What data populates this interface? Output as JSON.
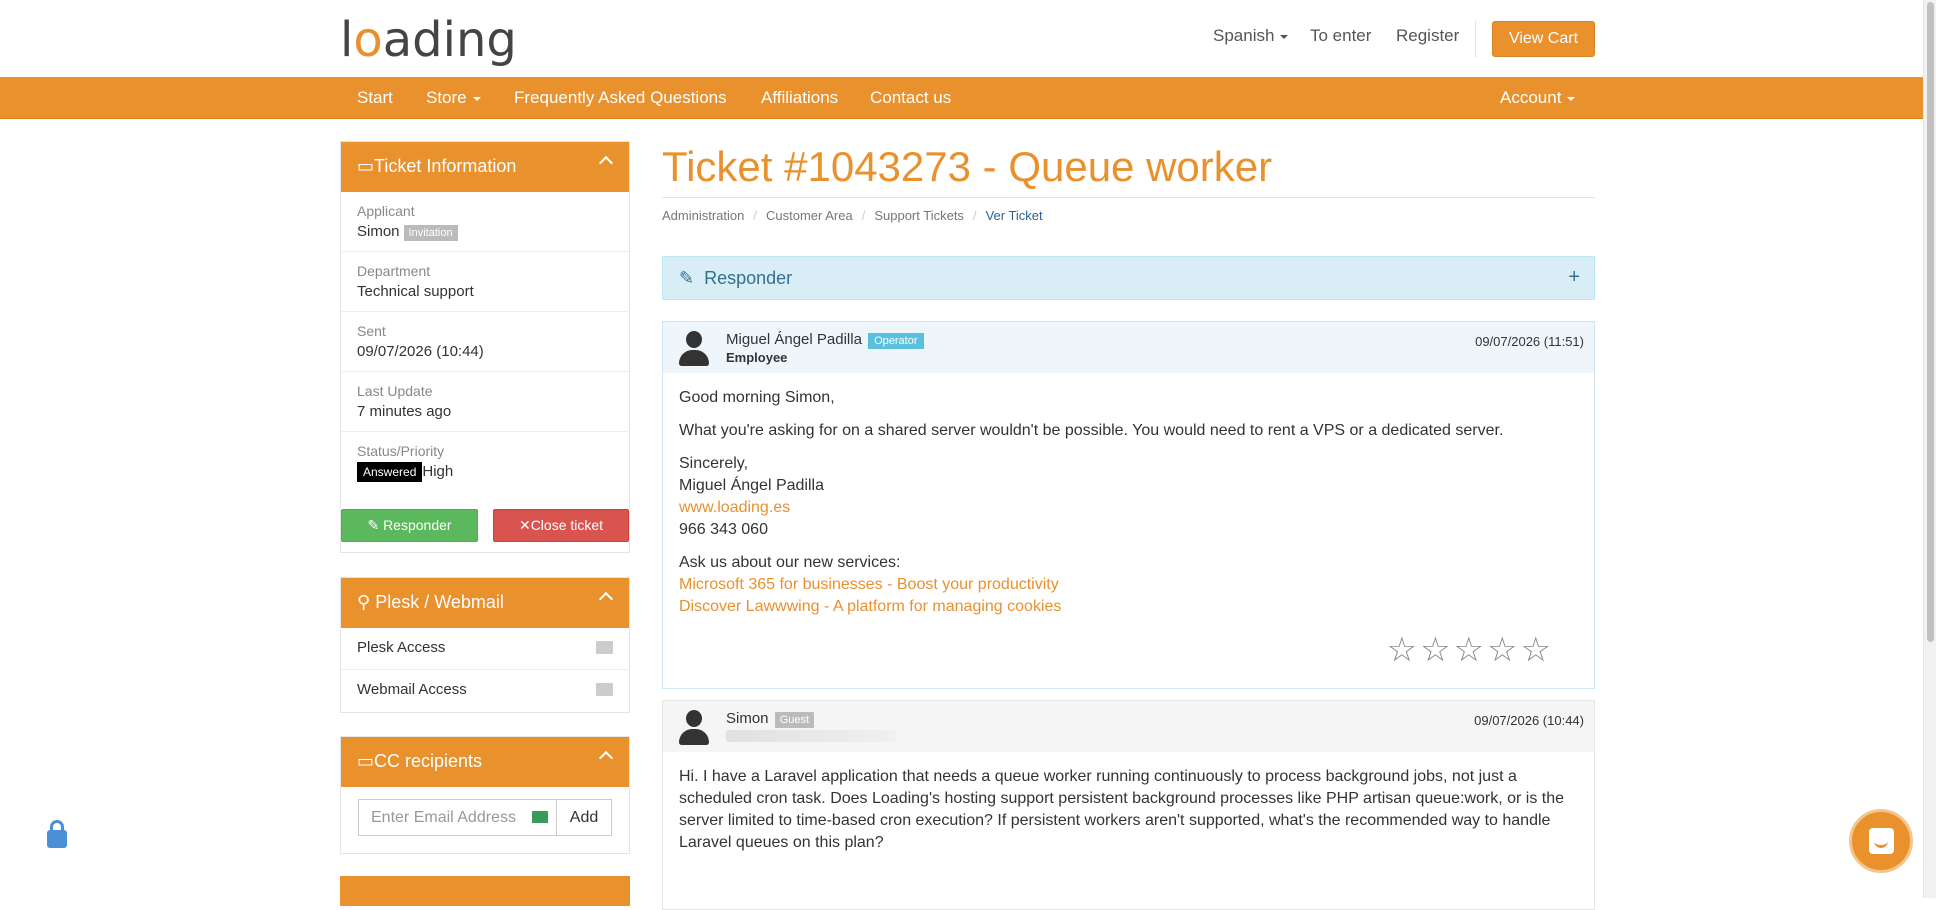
{
  "header": {
    "logo_pre": "l",
    "logo_o": "o",
    "logo_post": "ading",
    "language": "Spanish",
    "login": "To enter",
    "register": "Register",
    "cart": "View Cart"
  },
  "nav": {
    "start": "Start",
    "store": "Store",
    "faq": "Frequently Asked Questions",
    "affiliations": "Affiliations",
    "contact": "Contact us",
    "account": "Account"
  },
  "ticket_info": {
    "title": "Ticket Information",
    "applicant_label": "Applicant",
    "applicant_name": "Simon",
    "applicant_badge": "Invitation",
    "department_label": "Department",
    "department": "Technical support",
    "sent_label": "Sent",
    "sent": "09/07/2026 (10:44)",
    "update_label": "Last Update",
    "update": "7 minutes ago",
    "status_label": "Status/Priority",
    "status": "Answered",
    "priority": "High",
    "reply_btn": "Responder",
    "close_btn": "Close ticket"
  },
  "plesk": {
    "title": "Plesk / Webmail",
    "plesk_access": "Plesk Access",
    "webmail_access": "Webmail Access"
  },
  "cc": {
    "title": "CC recipients",
    "placeholder": "Enter Email Address",
    "add": "Add"
  },
  "main": {
    "title": "Ticket #1043273 - Queue worker",
    "crumbs": [
      "Administration",
      "Customer Area",
      "Support Tickets",
      "Ver Ticket"
    ],
    "responder": "Responder",
    "responder_plus": "+"
  },
  "messages": [
    {
      "name": "Miguel Ángel Padilla",
      "badge": "Operator",
      "role": "Employee",
      "date": "09/07/2026 (11:51)",
      "greeting": "Good morning Simon,",
      "body": "What you're asking for on a shared server wouldn't be possible. You would need to rent a VPS or a dedicated server.",
      "sign1": "Sincerely,",
      "sign2": "Miguel Ángel Padilla",
      "link": "www.loading.es",
      "phone": "966 343 060",
      "ask": "Ask us about our new services:",
      "service1": "Microsoft 365 for businesses - Boost your productivity",
      "service2": "Discover Lawwwing - A platform for managing cookies",
      "stars": "☆☆☆☆☆"
    },
    {
      "name": "Simon",
      "badge": "Guest",
      "date": "09/07/2026 (10:44)",
      "body": "Hi. I have a Laravel application that needs a queue worker running continuously to process background jobs, not just a scheduled cron task. Does Loading's hosting support persistent background processes like PHP artisan queue:work, or is the server limited to time-based cron execution? If persistent workers aren't supported, what's the recommended way to handle Laravel queues on this plan?"
    }
  ],
  "colors": {
    "brand": "#e8912d",
    "info_bg": "#d9edf7",
    "success": "#5cb85c",
    "danger": "#d9534f"
  }
}
